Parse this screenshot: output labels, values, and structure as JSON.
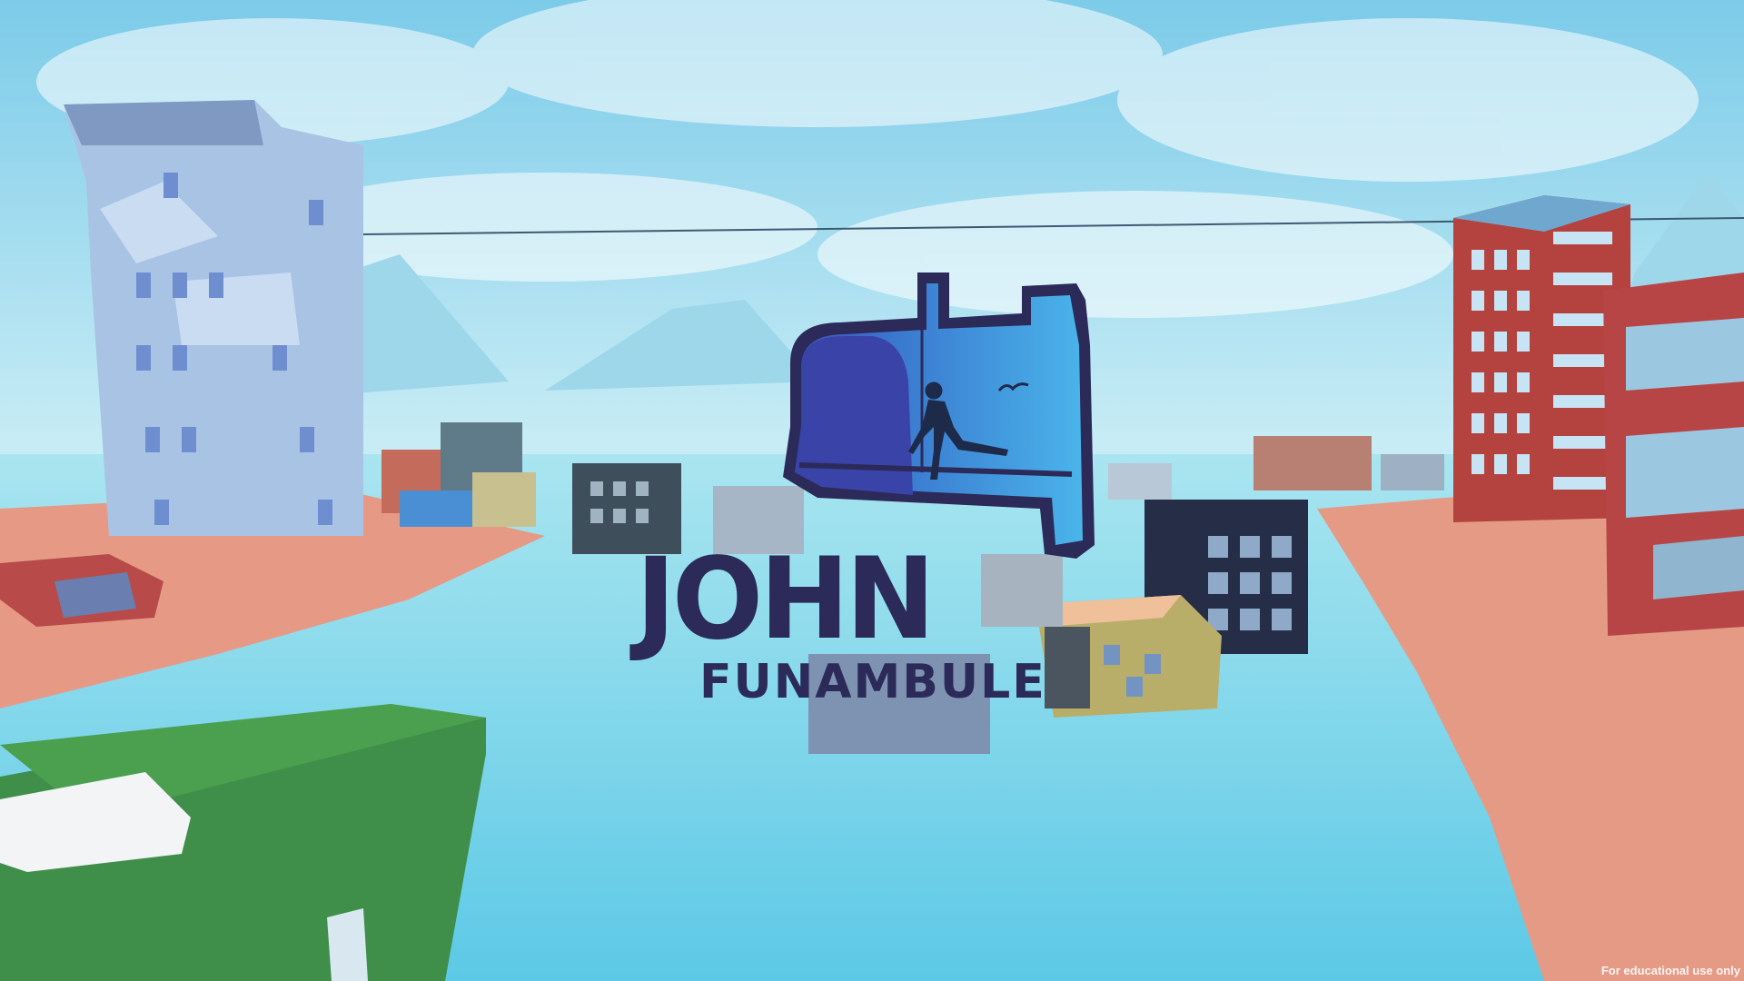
{
  "title": {
    "main": "JOHN",
    "sub": "FUNAMBULE"
  },
  "watermark": "For educational use only",
  "colors": {
    "sky": "#b9e6f3",
    "water": "#6fd4ea",
    "ground": "#e59a86",
    "logo_ink": "#2b2a59",
    "mailbox_blue": "#3a8fd6"
  },
  "icons": [
    "mailbox-icon",
    "tightrope-walker-icon",
    "bird-icon"
  ]
}
